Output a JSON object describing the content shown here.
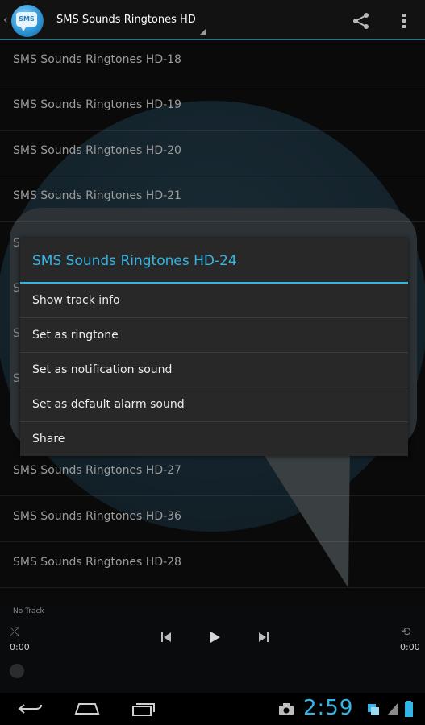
{
  "app": {
    "title": "SMS Sounds Ringtones HD",
    "logo_text": "SMS",
    "accent_color": "#33b5e5"
  },
  "action_bar": {
    "icons": [
      "share-icon",
      "overflow-menu-icon"
    ]
  },
  "tracks": {
    "rows": [
      "SMS Sounds Ringtones HD-18",
      "SMS Sounds Ringtones HD-19",
      "SMS Sounds Ringtones HD-20",
      "SMS Sounds Ringtones HD-21"
    ],
    "peek_rows": [
      "S",
      "S",
      "S",
      "S"
    ],
    "rows_after": [
      "SMS Sounds Ringtones HD-27",
      "SMS Sounds Ringtones HD-36",
      "SMS Sounds Ringtones HD-28"
    ]
  },
  "dialog": {
    "title": "SMS Sounds Ringtones HD-24",
    "items": [
      "Show track info",
      "Set as ringtone",
      "Set as notification sound",
      "Set as default alarm sound",
      "Share"
    ]
  },
  "player": {
    "status": "No Track",
    "time_elapsed": "0:00",
    "time_total": "0:00",
    "icons": [
      "shuffle-icon",
      "previous-icon",
      "play-icon",
      "next-icon",
      "repeat-icon"
    ]
  },
  "system_bar": {
    "clock": "2:59",
    "icons": [
      "back-icon",
      "home-icon",
      "recent-apps-icon",
      "camera-icon",
      "wifi-icon",
      "signal-icon",
      "battery-icon"
    ]
  }
}
